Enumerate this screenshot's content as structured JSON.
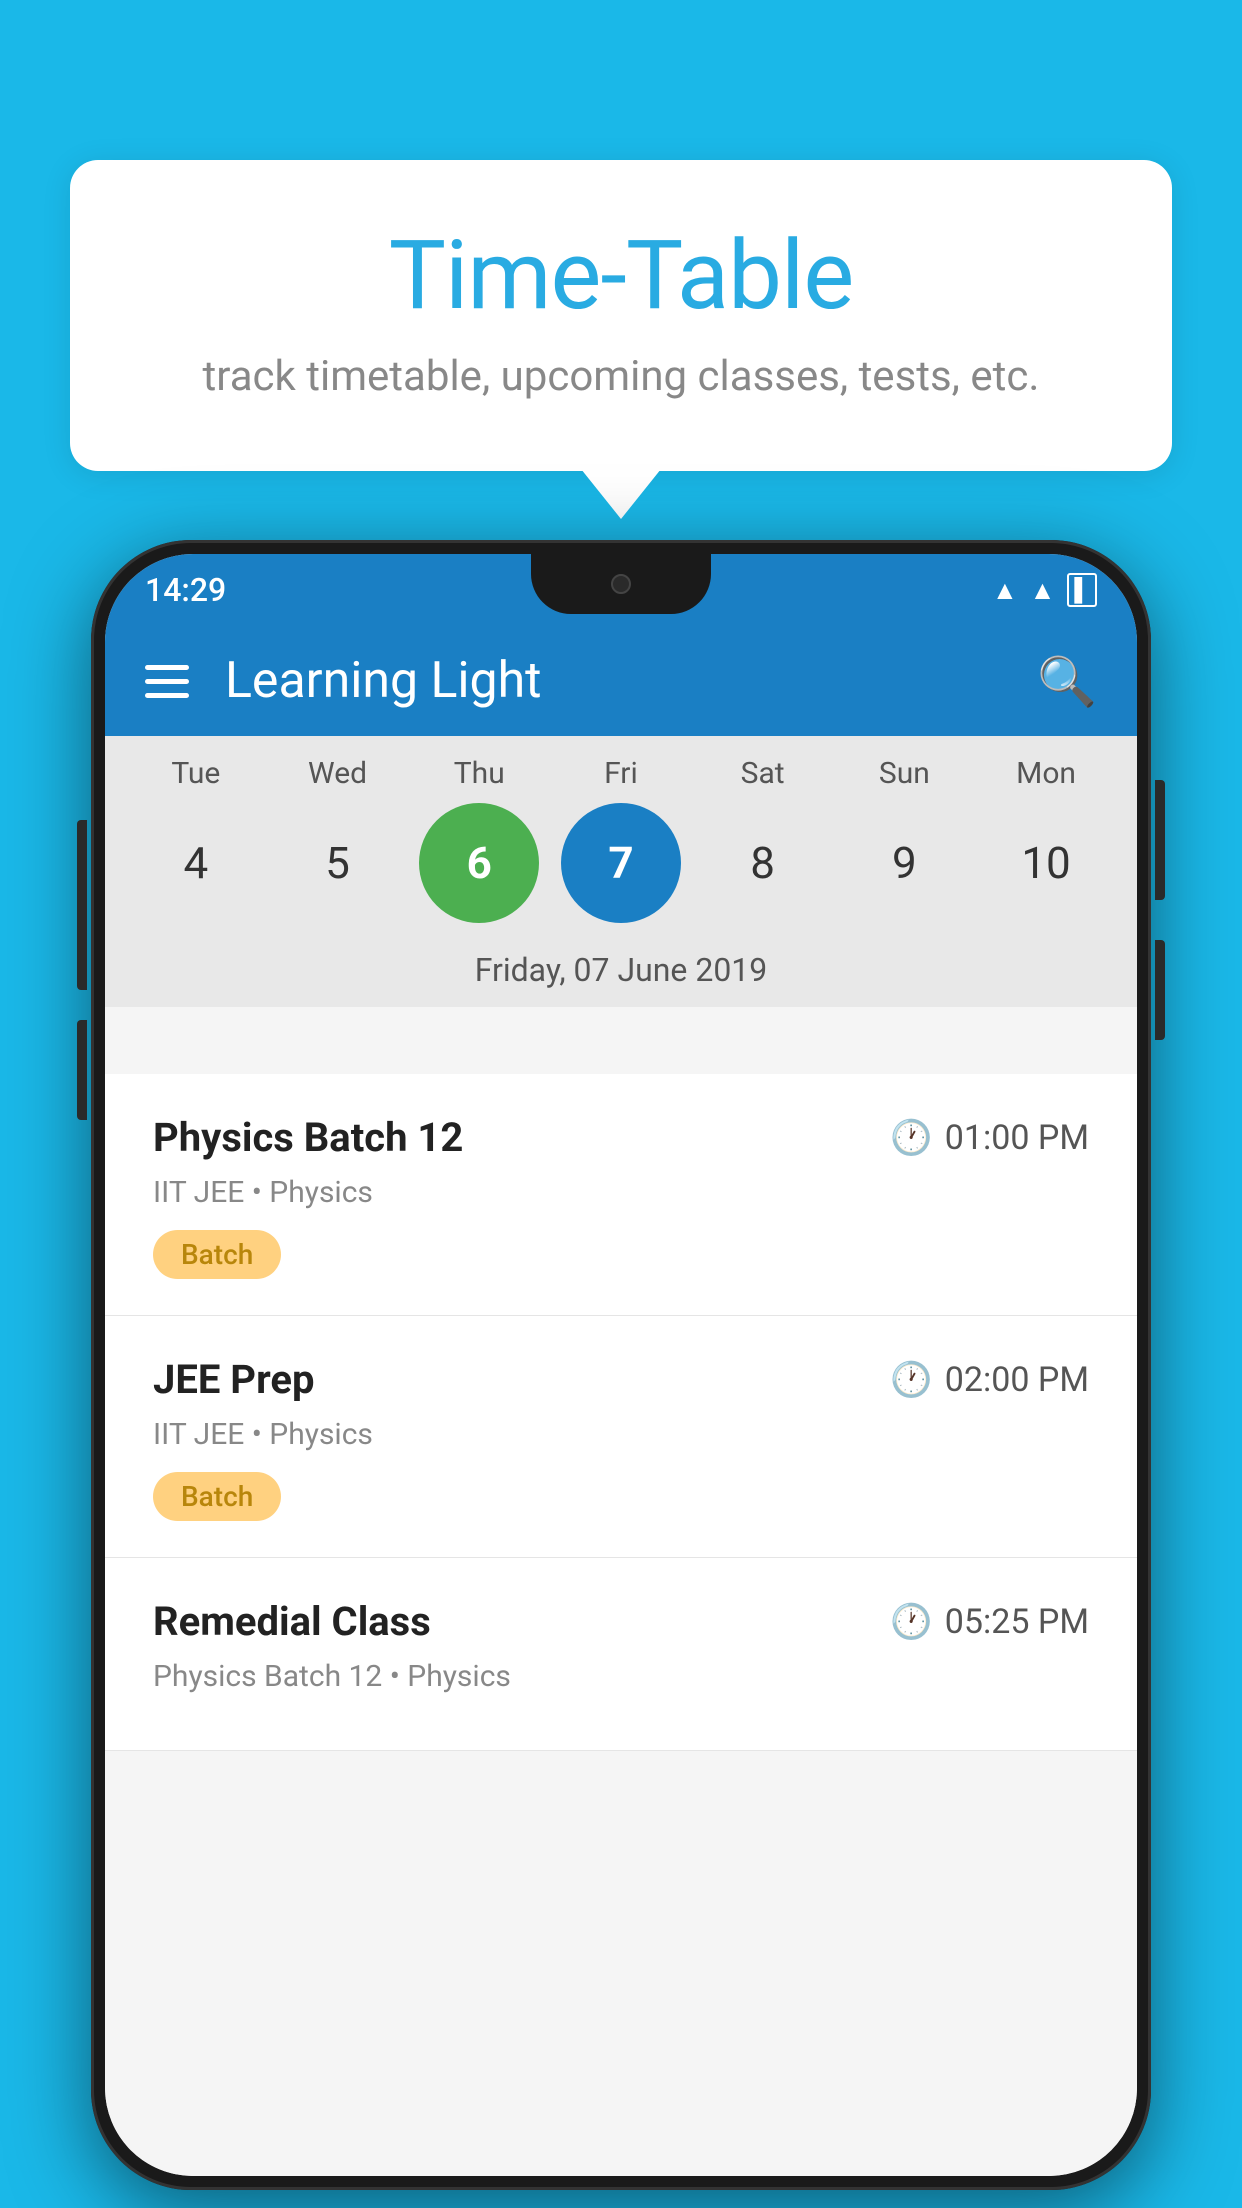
{
  "background_color": "#1ab8e8",
  "tooltip": {
    "title": "Time-Table",
    "subtitle": "track timetable, upcoming classes, tests, etc."
  },
  "phone": {
    "status_bar": {
      "time": "14:29"
    },
    "app_bar": {
      "title": "Learning Light"
    },
    "calendar": {
      "days": [
        {
          "label": "Tue",
          "number": "4"
        },
        {
          "label": "Wed",
          "number": "5"
        },
        {
          "label": "Thu",
          "number": "6",
          "state": "today"
        },
        {
          "label": "Fri",
          "number": "7",
          "state": "selected"
        },
        {
          "label": "Sat",
          "number": "8"
        },
        {
          "label": "Sun",
          "number": "9"
        },
        {
          "label": "Mon",
          "number": "10"
        }
      ],
      "selected_date": "Friday, 07 June 2019"
    },
    "classes": [
      {
        "name": "Physics Batch 12",
        "time": "01:00 PM",
        "subject": "IIT JEE • Physics",
        "badge": "Batch"
      },
      {
        "name": "JEE Prep",
        "time": "02:00 PM",
        "subject": "IIT JEE • Physics",
        "badge": "Batch"
      },
      {
        "name": "Remedial Class",
        "time": "05:25 PM",
        "subject": "Physics Batch 12 • Physics",
        "badge": ""
      }
    ]
  }
}
